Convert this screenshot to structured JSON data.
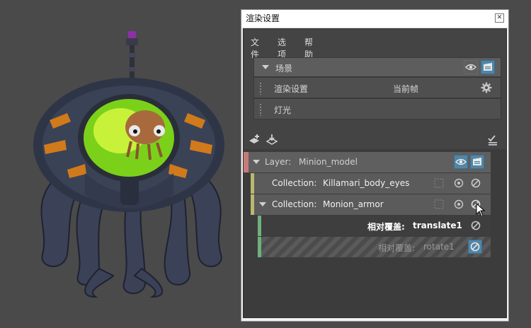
{
  "window": {
    "title": "渲染设置",
    "close_glyph": "✕"
  },
  "menu": [
    "文件",
    "选项",
    "帮助"
  ],
  "scene": {
    "label": "场景",
    "rows": [
      {
        "label": "渲染设置",
        "value": "当前帧"
      },
      {
        "label": "灯光"
      }
    ]
  },
  "toolbar": {
    "icons": [
      "add-layer-icon",
      "import-icon",
      "checklist-icon"
    ]
  },
  "layers": [
    {
      "prefix": "Layer:",
      "name": "Minion_model",
      "color": "#c77a7a"
    },
    {
      "prefix": "Collection:",
      "name": "Killamari_body_eyes",
      "color": "#b9b870"
    },
    {
      "prefix": "Collection:",
      "name": "Monion_armor",
      "color": "#b9b870"
    },
    {
      "prefix": "相对覆盖:",
      "name": "translate1",
      "color": "#6fb07d"
    },
    {
      "prefix": "相对覆盖:",
      "name": "rotate1",
      "color": "#6fb07d"
    }
  ],
  "colors": {
    "accent": "#5285a6",
    "panel": "#444444",
    "row": "#5b5b5b"
  }
}
